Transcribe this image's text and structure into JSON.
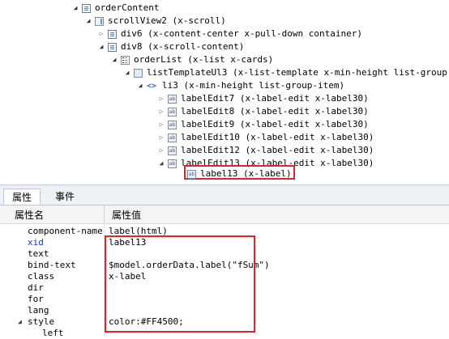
{
  "tree": {
    "nodes": [
      {
        "label": "orderContent",
        "icon": "div-box-icon",
        "toggle": "open"
      },
      {
        "label": "scrollView2 (x-scroll)",
        "icon": "scroll-view-icon",
        "toggle": "open"
      },
      {
        "label": "div6 (x-content-center x-pull-down container)",
        "icon": "div-icon",
        "toggle": "closed"
      },
      {
        "label": "div8 (x-scroll-content)",
        "icon": "div-icon",
        "toggle": "open"
      },
      {
        "label": "orderList (x-list x-cards)",
        "icon": "list-icon",
        "toggle": "open"
      },
      {
        "label": "listTemplateUl3 (x-list-template x-min-height list-group)",
        "icon": "template-icon",
        "toggle": "open"
      },
      {
        "label": "li3 (x-min-height list-group-item)",
        "icon": "code-tag-icon",
        "toggle": "open"
      },
      {
        "label": "labelEdit7 (x-label-edit x-label30)",
        "icon": "label-edit-icon",
        "toggle": "closed"
      },
      {
        "label": "labelEdit8 (x-label-edit x-label30)",
        "icon": "label-edit-icon",
        "toggle": "closed"
      },
      {
        "label": "labelEdit9 (x-label-edit x-label30)",
        "icon": "label-edit-icon",
        "toggle": "closed"
      },
      {
        "label": "labelEdit10 (x-label-edit x-label30)",
        "icon": "label-edit-icon",
        "toggle": "closed"
      },
      {
        "label": "labelEdit12 (x-label-edit x-label30)",
        "icon": "label-edit-icon",
        "toggle": "closed"
      },
      {
        "label": "labelEdit13 (x-label-edit x-label30)",
        "icon": "label-edit-icon",
        "toggle": "open"
      },
      {
        "label": "label13 (x-label)",
        "icon": "label-icon",
        "toggle": "none"
      }
    ]
  },
  "tabs": {
    "properties": "属性",
    "events": "事件"
  },
  "props_header": {
    "name": "属性名",
    "value": "属性值"
  },
  "props": [
    {
      "name": "component-name",
      "value": "label(html)"
    },
    {
      "name": "xid",
      "value": "label13"
    },
    {
      "name": "text",
      "value": ""
    },
    {
      "name": "bind-text",
      "value": "$model.orderData.label(\"fSum\")"
    },
    {
      "name": "class",
      "value": "x-label"
    },
    {
      "name": "dir",
      "value": ""
    },
    {
      "name": "for",
      "value": ""
    },
    {
      "name": "lang",
      "value": ""
    },
    {
      "name": "style",
      "value": "color:#FF4500;"
    },
    {
      "name": "left",
      "value": ""
    }
  ],
  "colors": {
    "highlight": "#e0262c",
    "xid_name": "#1a3ccf"
  }
}
